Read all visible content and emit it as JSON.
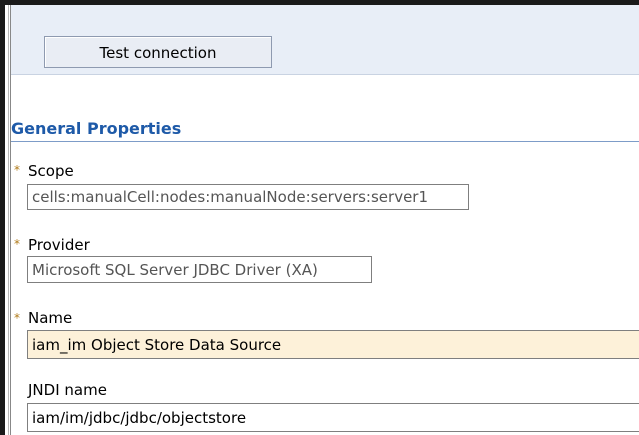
{
  "toolbar": {
    "test_connection_label": "Test connection"
  },
  "general_properties": {
    "title": "General Properties",
    "required_marker": "*",
    "scope": {
      "label": "Scope",
      "value": "cells:manualCell:nodes:manualNode:servers:server1"
    },
    "provider": {
      "label": "Provider",
      "value": "Microsoft SQL Server JDBC Driver (XA)"
    },
    "name": {
      "label": "Name",
      "value": "iam_im Object Store Data Source"
    },
    "jndi": {
      "label": "JNDI name",
      "value": "iam/im/jdbc/jdbc/objectstore"
    }
  },
  "colors": {
    "section_title": "#1e5aa8",
    "required_marker": "#b07a18",
    "highlight_field": "#fdf1d9",
    "toolbar_bg": "#e8eef7"
  }
}
